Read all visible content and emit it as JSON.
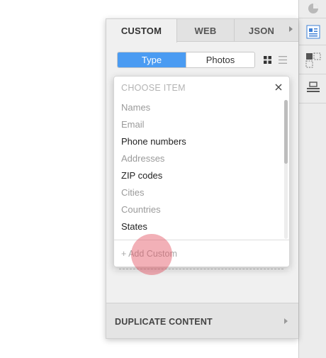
{
  "panel": {
    "tabs": [
      {
        "label": "CUSTOM",
        "active": true
      },
      {
        "label": "WEB",
        "active": false
      },
      {
        "label": "JSON",
        "active": false
      }
    ],
    "segmented": {
      "options": [
        "Type",
        "Photos"
      ],
      "selected": "Type"
    },
    "view_icons": [
      "grid-view-icon",
      "list-view-icon"
    ],
    "footer_label": "DUPLICATE CONTENT"
  },
  "dropdown": {
    "header": "CHOOSE ITEM",
    "items": [
      {
        "label": "Names",
        "enabled": false
      },
      {
        "label": "Email",
        "enabled": false
      },
      {
        "label": "Phone numbers",
        "enabled": true
      },
      {
        "label": "Addresses",
        "enabled": false
      },
      {
        "label": "ZIP codes",
        "enabled": true
      },
      {
        "label": "Cities",
        "enabled": false
      },
      {
        "label": "Countries",
        "enabled": false
      },
      {
        "label": "States",
        "enabled": true
      }
    ],
    "add_custom": "+ Add Custom"
  },
  "toolbar": {
    "icons": [
      "pie-chart-icon",
      "content-panel-icon",
      "layout-icon",
      "stack-icon"
    ]
  },
  "colors": {
    "accent": "#4a9bf2",
    "cursor": "#e2505f"
  }
}
